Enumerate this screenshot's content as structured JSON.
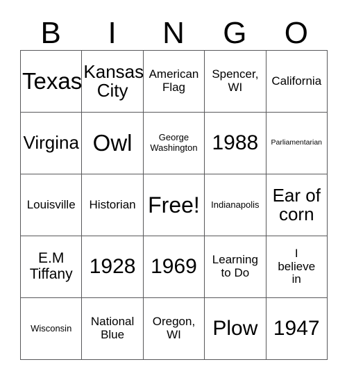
{
  "card": {
    "title": "BINGO",
    "header_letters": [
      "B",
      "I",
      "N",
      "G",
      "O"
    ],
    "grid_line_color": "#58585a",
    "text_color": "#000000",
    "background_color": "#ffffff",
    "free_space": {
      "row": 2,
      "col": 2,
      "label": "Free!"
    },
    "rows": [
      [
        {
          "text": "Texas",
          "size": "fs-huge"
        },
        {
          "text": "Kansas\nCity",
          "size": "fs-xl"
        },
        {
          "text": "American\nFlag",
          "size": "fs-md"
        },
        {
          "text": "Spencer,\nWI",
          "size": "fs-md"
        },
        {
          "text": "California",
          "size": "fs-md"
        }
      ],
      [
        {
          "text": "Virgina",
          "size": "fs-xl"
        },
        {
          "text": "Owl",
          "size": "fs-huge"
        },
        {
          "text": "George\nWashington",
          "size": "fs-sm"
        },
        {
          "text": "1988",
          "size": "fs-xxl"
        },
        {
          "text": "Parliamentarian",
          "size": "fs-xs"
        }
      ],
      [
        {
          "text": "Louisville",
          "size": "fs-md"
        },
        {
          "text": "Historian",
          "size": "fs-md"
        },
        {
          "text": "Free!",
          "size": "fs-free"
        },
        {
          "text": "Indianapolis",
          "size": "fs-sm"
        },
        {
          "text": "Ear of\ncorn",
          "size": "fs-xl"
        }
      ],
      [
        {
          "text": "E.M\nTiffany",
          "size": "fs-lg"
        },
        {
          "text": "1928",
          "size": "fs-xxl"
        },
        {
          "text": "1969",
          "size": "fs-xxl"
        },
        {
          "text": "Learning\nto Do",
          "size": "fs-md"
        },
        {
          "text": "I\nbelieve\nin",
          "size": "fs-md"
        }
      ],
      [
        {
          "text": "Wisconsin",
          "size": "fs-sm"
        },
        {
          "text": "National\nBlue",
          "size": "fs-md"
        },
        {
          "text": "Oregon,\nWI",
          "size": "fs-md"
        },
        {
          "text": "Plow",
          "size": "fs-xxl"
        },
        {
          "text": "1947",
          "size": "fs-xxl"
        }
      ]
    ]
  }
}
